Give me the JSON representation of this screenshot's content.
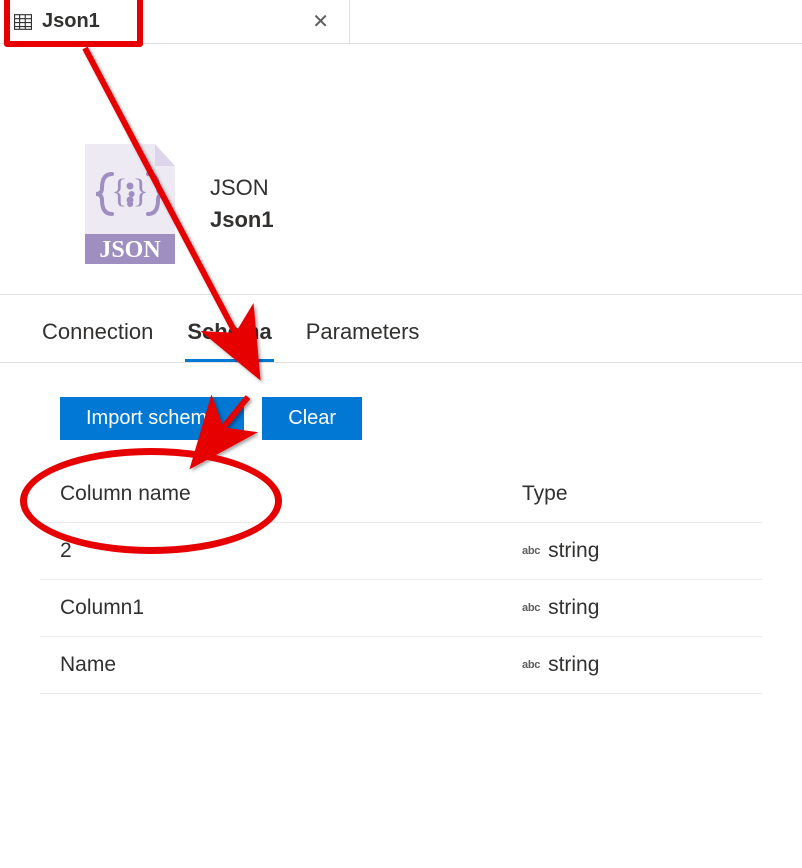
{
  "tab": {
    "label": "Json1"
  },
  "summary": {
    "file_type": "JSON",
    "dataset_name": "Json1",
    "badge": "JSON"
  },
  "detail_tabs": {
    "connection": "Connection",
    "schema": "Schema",
    "parameters": "Parameters"
  },
  "buttons": {
    "import_schema": "Import schema",
    "clear": "Clear"
  },
  "schema": {
    "header_name": "Column name",
    "header_type": "Type",
    "type_prefix": "abc",
    "rows": [
      {
        "name": "2",
        "type": "string"
      },
      {
        "name": "Column1",
        "type": "string"
      },
      {
        "name": "Name",
        "type": "string"
      }
    ]
  }
}
